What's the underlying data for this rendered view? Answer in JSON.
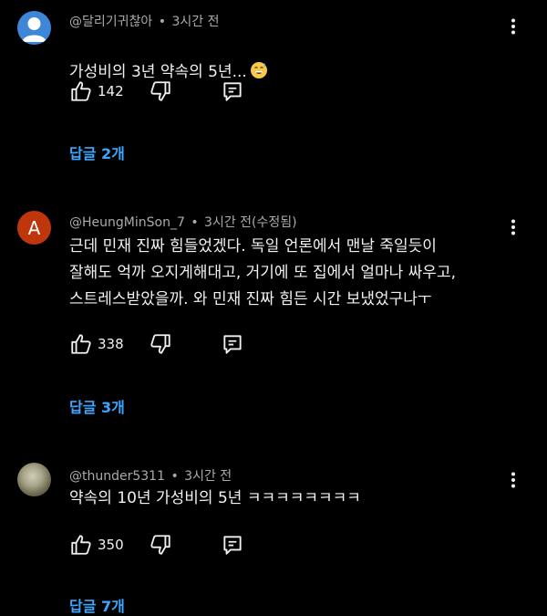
{
  "comments": [
    {
      "author": "@달리기귀찮아",
      "separator": "•",
      "time": "3시간 전",
      "text": "가성비의 3년 약속의 5년...",
      "emoji": "grinning-sweat-emoji",
      "likes": "142",
      "replies": "답글 2개"
    },
    {
      "author": "@HeungMinSon_7",
      "separator": "•",
      "time": "3시간 전(수정됨)",
      "avatar_letter": "A",
      "text": "근데 민재 진짜 힘들었겠다. 독일 언론에서 맨날 죽일듯이\n잘해도 억까 오지게해대고, 거기에 또 집에서 얼마나 싸우고,\n스트레스받았을까. 와 민재 진짜 힘든 시간 보냈었구나ㅜ",
      "likes": "338",
      "replies": "답글 3개"
    },
    {
      "author": "@thunder5311",
      "separator": "•",
      "time": "3시간 전",
      "text": "약속의 10년 가성비의 5년 ㅋㅋㅋㅋㅋㅋㅋㅋ",
      "likes": "350",
      "replies": "답글 7개"
    }
  ],
  "icons": {
    "like": "thumbs-up-icon",
    "dislike": "thumbs-down-icon",
    "reply": "reply-comment-icon",
    "menu": "more-vertical-icon"
  },
  "colors": {
    "background": "#000000",
    "text": "#f1f1f1",
    "meta": "#aaaaaa",
    "link": "#3ea6ff",
    "avatar_default": "#3d86d8",
    "avatar_letter": "#bf360c"
  }
}
